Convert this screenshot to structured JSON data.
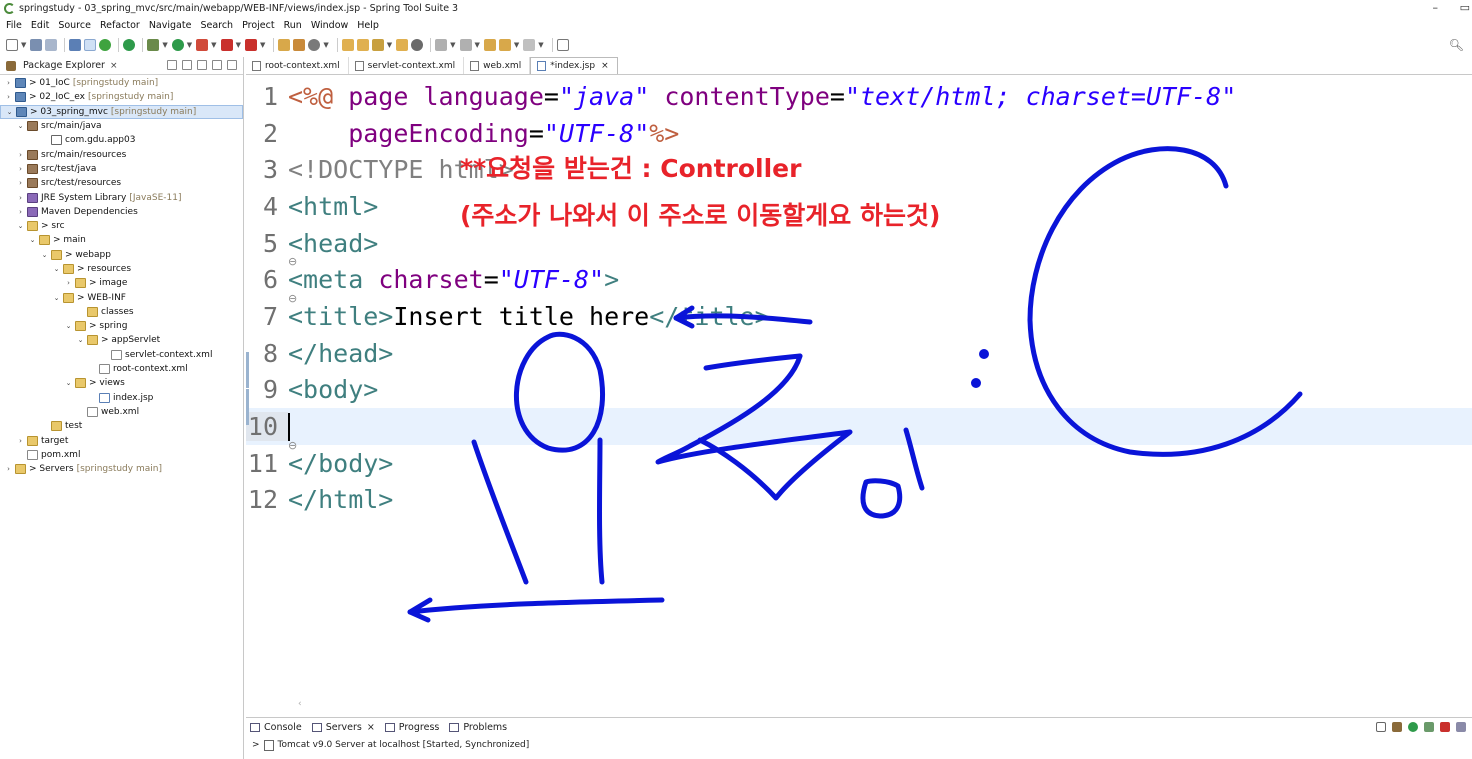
{
  "window": {
    "title": "springstudy - 03_spring_mvc/src/main/webapp/WEB-INF/views/index.jsp - Spring Tool Suite 3",
    "minimize": "–",
    "restore": "▭"
  },
  "menu": [
    "File",
    "Edit",
    "Source",
    "Refactor",
    "Navigate",
    "Search",
    "Project",
    "Run",
    "Window",
    "Help"
  ],
  "explorer": {
    "tab_label": "Package Explorer",
    "tree": [
      {
        "text": "> 01_IoC",
        "deco": "[springstudy main]",
        "twisty": ">",
        "icon": "project"
      },
      {
        "text": "> 02_IoC_ex",
        "deco": "[springstudy main]",
        "twisty": ">",
        "icon": "project"
      },
      {
        "text": "> 03_spring_mvc",
        "deco": "[springstudy main]",
        "twisty": "v",
        "icon": "project"
      },
      {
        "text": "src/main/java",
        "deco": "",
        "twisty": "v",
        "icon": "jar"
      },
      {
        "text": "com.gdu.app03",
        "deco": "",
        "twisty": "",
        "icon": "pkg"
      },
      {
        "text": "src/main/resources",
        "deco": "",
        "twisty": ">",
        "icon": "jar"
      },
      {
        "text": "src/test/java",
        "deco": "",
        "twisty": ">",
        "icon": "jar"
      },
      {
        "text": "src/test/resources",
        "deco": "",
        "twisty": ">",
        "icon": "jar"
      },
      {
        "text": "JRE System Library",
        "deco": "[JavaSE-11]",
        "twisty": ">",
        "icon": "lib"
      },
      {
        "text": "Maven Dependencies",
        "deco": "",
        "twisty": ">",
        "icon": "lib"
      },
      {
        "text": "> src",
        "deco": "",
        "twisty": "v",
        "icon": "folder"
      },
      {
        "text": "> main",
        "deco": "",
        "twisty": "v",
        "icon": "folder"
      },
      {
        "text": "> webapp",
        "deco": "",
        "twisty": "v",
        "icon": "folder"
      },
      {
        "text": "> resources",
        "deco": "",
        "twisty": "v",
        "icon": "folder"
      },
      {
        "text": "> image",
        "deco": "",
        "twisty": ">",
        "icon": "folder"
      },
      {
        "text": "> WEB-INF",
        "deco": "",
        "twisty": "v",
        "icon": "folder"
      },
      {
        "text": "classes",
        "deco": "",
        "twisty": "",
        "icon": "folder"
      },
      {
        "text": "> spring",
        "deco": "",
        "twisty": "v",
        "icon": "folder"
      },
      {
        "text": "> appServlet",
        "deco": "",
        "twisty": "v",
        "icon": "folder"
      },
      {
        "text": "servlet-context.xml",
        "deco": "",
        "twisty": "",
        "icon": "xml"
      },
      {
        "text": "root-context.xml",
        "deco": "",
        "twisty": "",
        "icon": "xml"
      },
      {
        "text": "> views",
        "deco": "",
        "twisty": "v",
        "icon": "folder"
      },
      {
        "text": "index.jsp",
        "deco": "",
        "twisty": "",
        "icon": "jsp"
      },
      {
        "text": "web.xml",
        "deco": "",
        "twisty": "",
        "icon": "xml"
      },
      {
        "text": "test",
        "deco": "",
        "twisty": "",
        "icon": "folder"
      },
      {
        "text": "target",
        "deco": "",
        "twisty": ">",
        "icon": "folder"
      },
      {
        "text": "pom.xml",
        "deco": "",
        "twisty": "",
        "icon": "xml"
      },
      {
        "text": "> Servers",
        "deco": "[springstudy main]",
        "twisty": ">",
        "icon": "folder"
      }
    ]
  },
  "editor_tabs": [
    {
      "label": "root-context.xml"
    },
    {
      "label": "servlet-context.xml"
    },
    {
      "label": "web.xml"
    },
    {
      "label": "*index.jsp",
      "close": "×"
    }
  ],
  "code": {
    "line_numbers": [
      "1",
      "2",
      "3",
      "4",
      "5",
      "6",
      "7",
      "8",
      "9",
      "10",
      "11",
      "12"
    ],
    "l1": {
      "a": "<%@",
      "b": " page ",
      "c": "language",
      "d": "=",
      "e": "\"java\"",
      "f": " contentType",
      "g": "=",
      "h": "\"text/html; charset=UTF-8\""
    },
    "l2": {
      "a": "    pageEncoding",
      "b": "=",
      "c": "\"UTF-8\"",
      "d": "%>"
    },
    "l3": "<!DOCTYPE html>",
    "l4": "<html>",
    "l5": "<head>",
    "l6": {
      "a": "<meta",
      "b": " charset",
      "c": "=",
      "d": "\"UTF-8\"",
      "e": ">"
    },
    "l7": {
      "a": "<title>",
      "b": "Insert title here",
      "c": "</title>"
    },
    "l8": "</head>",
    "l9": "<body>",
    "l11": "</body>",
    "l12": "</html>"
  },
  "annotation": {
    "line1": "**요청을 받는건 : Controller",
    "line2": "(주소가 나와서 이 주소로 이동할게요 하는것)",
    "color": "#e8232a",
    "ink_color": "#0a14d8"
  },
  "bottom_panel": {
    "tabs": [
      {
        "label": "Console",
        "close": ""
      },
      {
        "label": "Servers",
        "close": "×"
      },
      {
        "label": "Progress",
        "close": ""
      },
      {
        "label": "Problems",
        "close": ""
      }
    ],
    "server_row": "Tomcat v9.0 Server at localhost  [Started, Synchronized]"
  }
}
